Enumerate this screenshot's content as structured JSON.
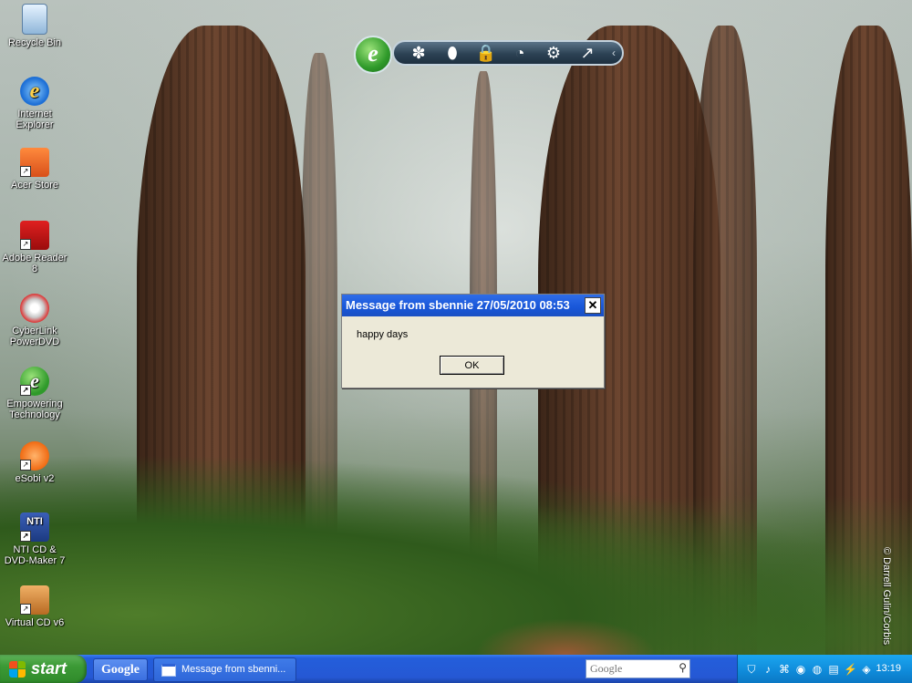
{
  "desktop": {
    "icons": [
      {
        "label": "Recycle Bin",
        "icon": "recycle-bin-icon"
      },
      {
        "label": "Internet Explorer",
        "icon": "internet-explorer-icon"
      },
      {
        "label": "Acer Store",
        "icon": "acer-store-icon"
      },
      {
        "label": "Adobe Reader 8",
        "icon": "adobe-reader-icon"
      },
      {
        "label": "CyberLink PowerDVD",
        "icon": "powerdvd-icon"
      },
      {
        "label": "Empowering Technology",
        "icon": "empowering-technology-icon"
      },
      {
        "label": "eSobi v2",
        "icon": "esobi-icon"
      },
      {
        "label": "NTI CD & DVD-Maker 7",
        "icon": "nti-cd-dvd-maker-icon"
      },
      {
        "label": "Virtual CD v6",
        "icon": "virtual-cd-icon"
      }
    ],
    "copyright": "© Darrell Gulin/Corbis"
  },
  "etoolbar": {
    "logo_glyph": "e",
    "buttons": [
      {
        "icon": "fan-icon",
        "glyph": "✽"
      },
      {
        "icon": "keyhole-icon",
        "glyph": "⬮"
      },
      {
        "icon": "lock-icon",
        "glyph": "🔒"
      },
      {
        "icon": "pie-chart-icon",
        "glyph": "◔"
      },
      {
        "icon": "gear-icon",
        "glyph": "⚙"
      },
      {
        "icon": "trend-arrow-icon",
        "glyph": "↗"
      },
      {
        "icon": "collapse-arrow-icon",
        "glyph": "‹"
      }
    ]
  },
  "dialog": {
    "title": "Message from sbennie 27/05/2010 08:53",
    "message": "happy days",
    "ok_label": "OK",
    "close_glyph": "✕"
  },
  "taskbar": {
    "start_label": "start",
    "google_label": "Google",
    "task_button_label": "Message from sbenni...",
    "search_placeholder": "Google",
    "clock": "13:19",
    "colors": {
      "taskbar": "#245edb",
      "start": "#3c9a36",
      "tray": "#0f8ad9"
    }
  }
}
